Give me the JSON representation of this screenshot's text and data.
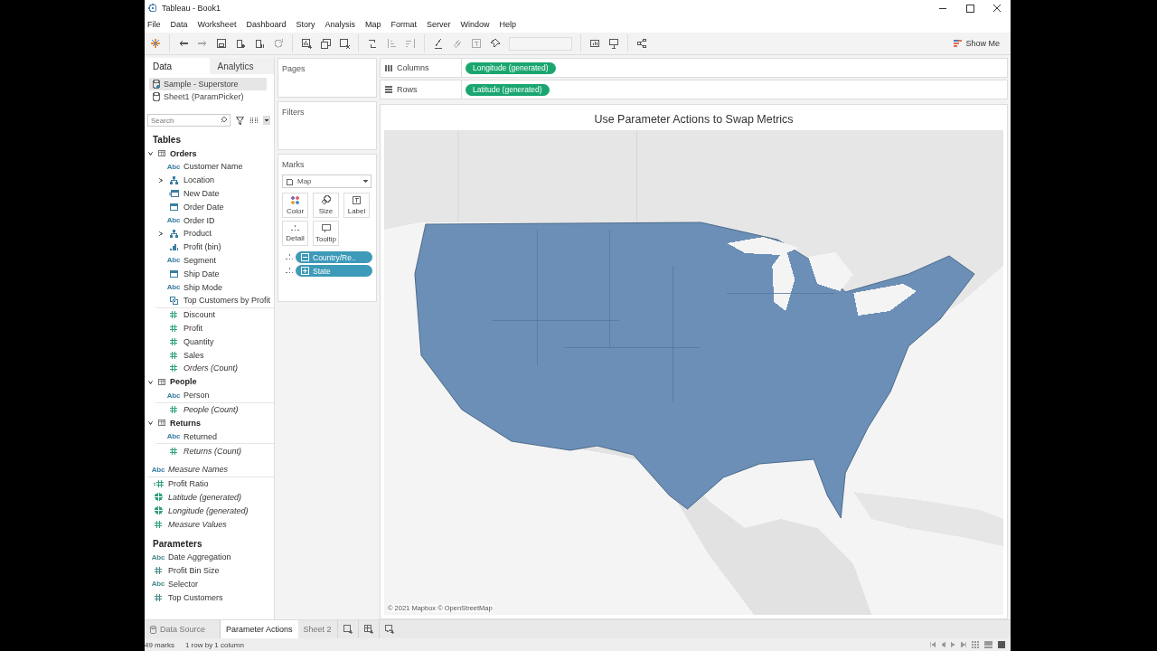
{
  "window": {
    "title": "Tableau - Book1"
  },
  "menu": [
    "File",
    "Data",
    "Worksheet",
    "Dashboard",
    "Story",
    "Analysis",
    "Map",
    "Format",
    "Server",
    "Window",
    "Help"
  ],
  "toolbar": {
    "show_me": "Show Me"
  },
  "data_pane": {
    "tabs": [
      {
        "label": "Data",
        "selected": true
      },
      {
        "label": "Analytics",
        "selected": false
      }
    ],
    "data_sources": [
      {
        "name": "Sample - Superstore",
        "selected": true
      },
      {
        "name": "Sheet1 (ParamPicker)",
        "selected": false
      }
    ],
    "search": {
      "placeholder": "Search"
    },
    "tables_heading": "Tables",
    "tables": [
      {
        "name": "Orders",
        "expanded": true,
        "fields": [
          {
            "name": "Customer Name",
            "kind": "string",
            "type_label": "Abc",
            "color": "#3b7ea1",
            "generated": false
          },
          {
            "name": "Location",
            "kind": "hierarchy",
            "color": "#3b7ea1",
            "generated": false,
            "expanded": false
          },
          {
            "name": "New Date",
            "kind": "calc-date",
            "color": "#3b7ea1",
            "generated": false
          },
          {
            "name": "Order Date",
            "kind": "date",
            "color": "#3b7ea1",
            "generated": false
          },
          {
            "name": "Order ID",
            "kind": "string",
            "type_label": "Abc",
            "color": "#3b7ea1",
            "generated": false
          },
          {
            "name": "Product",
            "kind": "hierarchy",
            "color": "#3b7ea1",
            "generated": false,
            "expanded": false
          },
          {
            "name": "Profit (bin)",
            "kind": "bin",
            "color": "#3b7ea1",
            "generated": false
          },
          {
            "name": "Segment",
            "kind": "string",
            "type_label": "Abc",
            "color": "#3b7ea1",
            "generated": false
          },
          {
            "name": "Ship Date",
            "kind": "date",
            "color": "#3b7ea1",
            "generated": false
          },
          {
            "name": "Ship Mode",
            "kind": "string",
            "type_label": "Abc",
            "color": "#3b7ea1",
            "generated": false
          },
          {
            "name": "Top Customers by Profit",
            "kind": "set",
            "color": "#3b7ea1",
            "generated": false
          },
          {
            "name": "Discount",
            "kind": "number",
            "color": "#2fa37a",
            "generated": false
          },
          {
            "name": "Profit",
            "kind": "number",
            "color": "#2fa37a",
            "generated": false
          },
          {
            "name": "Quantity",
            "kind": "number",
            "color": "#2fa37a",
            "generated": false
          },
          {
            "name": "Sales",
            "kind": "number",
            "color": "#2fa37a",
            "generated": false
          },
          {
            "name": "Orders (Count)",
            "kind": "number",
            "color": "#2fa37a",
            "generated": true
          }
        ]
      },
      {
        "name": "People",
        "expanded": true,
        "fields": [
          {
            "name": "Person",
            "kind": "string",
            "type_label": "Abc",
            "color": "#3b7ea1",
            "generated": false
          },
          {
            "name": "People (Count)",
            "kind": "number",
            "color": "#2fa37a",
            "generated": true
          }
        ]
      },
      {
        "name": "Returns",
        "expanded": true,
        "fields": [
          {
            "name": "Returned",
            "kind": "string",
            "type_label": "Abc",
            "color": "#3b7ea1",
            "generated": false
          },
          {
            "name": "Returns (Count)",
            "kind": "number",
            "color": "#2fa37a",
            "generated": true
          }
        ]
      }
    ],
    "loose_fields": [
      {
        "name": "Measure Names",
        "kind": "string",
        "type_label": "Abc",
        "color": "#3b7ea1",
        "generated": true
      },
      {
        "name": "Profit Ratio",
        "kind": "calc-number",
        "color": "#2fa37a",
        "generated": false
      },
      {
        "name": "Latitude (generated)",
        "kind": "geo",
        "color": "#2fa37a",
        "generated": true
      },
      {
        "name": "Longitude (generated)",
        "kind": "geo",
        "color": "#2fa37a",
        "generated": true
      },
      {
        "name": "Measure Values",
        "kind": "number",
        "color": "#2fa37a",
        "generated": true
      }
    ],
    "parameters_heading": "Parameters",
    "parameters": [
      {
        "name": "Date Aggregation",
        "kind": "string",
        "type_label": "Abc",
        "color": "#4c8a8a",
        "generated": false
      },
      {
        "name": "Profit Bin Size",
        "kind": "number",
        "color": "#4c8a8a",
        "generated": false
      },
      {
        "name": "Selector",
        "kind": "string",
        "type_label": "Abc",
        "color": "#4c8a8a",
        "generated": false
      },
      {
        "name": "Top Customers",
        "kind": "number",
        "color": "#4c8a8a",
        "generated": false
      }
    ]
  },
  "pages": {
    "label": "Pages"
  },
  "filters": {
    "label": "Filters"
  },
  "marks": {
    "label": "Marks",
    "mark_type": "Map",
    "buttons": [
      {
        "label": "Color",
        "kind": "color"
      },
      {
        "label": "Size",
        "kind": "size"
      },
      {
        "label": "Label",
        "kind": "label"
      },
      {
        "label": "Detail",
        "kind": "detail"
      },
      {
        "label": "Tooltip",
        "kind": "tooltip"
      }
    ],
    "pills": [
      {
        "label": "Country/Re..",
        "expanded": true
      },
      {
        "label": "State",
        "expanded": false
      }
    ]
  },
  "shelves": [
    {
      "label": "Columns",
      "kind": "columns",
      "pill": "Longitude (generated)"
    },
    {
      "label": "Rows",
      "kind": "rows",
      "pill": "Latitude (generated)"
    }
  ],
  "view": {
    "title": "Use Parameter Actions to Swap Metrics",
    "attribution": "© 2021 Mapbox © OpenStreetMap"
  },
  "sheet_tabs": [
    {
      "label": "Data Source",
      "kind": "data-source",
      "selected": false
    },
    {
      "label": "Parameter Actions",
      "kind": "sheet",
      "selected": true
    },
    {
      "label": "Sheet 2",
      "kind": "sheet",
      "selected": false
    }
  ],
  "status_bar": {
    "marks": "49 marks",
    "layout": "1 row by 1 column"
  }
}
